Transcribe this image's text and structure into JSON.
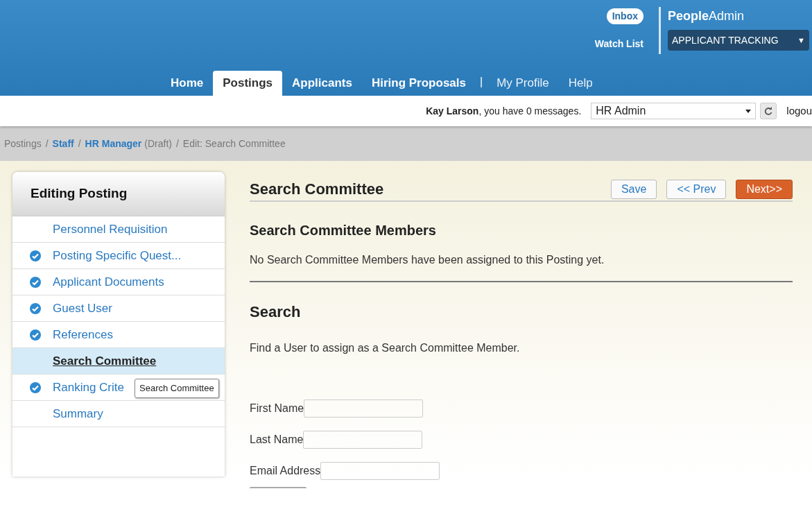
{
  "header": {
    "inbox": "Inbox",
    "watch_list": "Watch List",
    "brand_bold": "People",
    "brand_light": "Admin",
    "module": "APPLICANT TRACKING",
    "module_caret": "▼"
  },
  "nav_separator": "|",
  "breadcrumb_separator": "/",
  "nav": [
    {
      "label": "Home",
      "kind": "primary",
      "selected": false
    },
    {
      "label": "Postings",
      "kind": "primary",
      "selected": true
    },
    {
      "label": "Applicants",
      "kind": "primary",
      "selected": false
    },
    {
      "label": "Hiring Proposals",
      "kind": "primary",
      "selected": false
    },
    {
      "label": "My Profile",
      "kind": "secondary",
      "selected": false
    },
    {
      "label": "Help",
      "kind": "secondary",
      "selected": false
    }
  ],
  "user_bar": {
    "message": "**Kay Larson**, you have 0 messages.",
    "role": "HR Admin",
    "logout": "logou"
  },
  "breadcrumb": [
    {
      "label": "Postings",
      "kind": "plain"
    },
    {
      "label": "Staff",
      "kind": "link"
    },
    {
      "label": "HR Manager",
      "kind": "link",
      "note": "(Draft)"
    },
    {
      "label": "Edit: Search Committee",
      "kind": "plain"
    }
  ],
  "sidebar": {
    "title": "Editing Posting",
    "items": [
      {
        "label": "Personnel Requisition",
        "checked": false,
        "selected": false
      },
      {
        "label": "Posting Specific Quest...",
        "checked": true,
        "selected": false
      },
      {
        "label": "Applicant Documents",
        "checked": true,
        "selected": false
      },
      {
        "label": "Guest User",
        "checked": true,
        "selected": false
      },
      {
        "label": "References",
        "checked": true,
        "selected": false
      },
      {
        "label": "Search Committee",
        "checked": false,
        "selected": true
      },
      {
        "label": "Ranking Crite",
        "checked": true,
        "selected": false
      },
      {
        "label": "Summary",
        "checked": false,
        "selected": false
      }
    ],
    "tooltip": "Search Committee"
  },
  "main": {
    "title": "Search Committee",
    "buttons": [
      {
        "label": "Save",
        "kind": "secondary"
      },
      {
        "label": "<< Prev",
        "kind": "secondary"
      },
      {
        "label": "Next>>",
        "kind": "primary"
      }
    ],
    "members_title": "Search Committee Members",
    "members_text": "No Search Committee Members have been assigned to this Posting yet.",
    "search_title": "Search",
    "search_text": "Find a User to assign as a Search Committee Member.",
    "fields": [
      {
        "label": "First Name"
      },
      {
        "label": "Last Name"
      },
      {
        "label": "Email Address"
      }
    ]
  }
}
